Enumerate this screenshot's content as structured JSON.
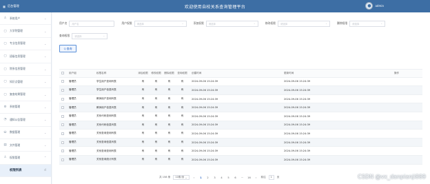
{
  "brand": {
    "name": "后台管理"
  },
  "header": {
    "title": "欢迎使用自校关系查询管理平台",
    "username": "admin"
  },
  "sidebar": {
    "items": [
      {
        "label": "系统用户"
      },
      {
        "label": "大学院管理"
      },
      {
        "label": "专业信息管理"
      },
      {
        "label": "班级信息管理"
      },
      {
        "label": "院系信息管理"
      },
      {
        "label": "知识点管理"
      },
      {
        "label": "复查结果管理"
      },
      {
        "label": "系统管理"
      },
      {
        "label": "通知公告管理"
      },
      {
        "label": "数据管理"
      },
      {
        "label": "文件管理"
      },
      {
        "label": "权限管理"
      },
      {
        "label": "权限列表"
      }
    ]
  },
  "filters": {
    "username_label": "用户名",
    "username_placeholder": "用户名",
    "perm1_label": "用户权限",
    "perm1_placeholder": "请选择",
    "perm2_label": "添加权限",
    "perm2_placeholder": "请选择",
    "perm3_label": "修改权限",
    "perm3_placeholder": "请选择",
    "perm4_label": "删除权限",
    "perm4_placeholder": "请选择",
    "perm5_label": "查询权限",
    "perm5_placeholder": "请选择",
    "search_button": "Q 查询"
  },
  "table": {
    "headers": [
      "用户组",
      "权限名称",
      "添加权限",
      "修改权限",
      "删除权限",
      "查询权限",
      "创建时间",
      "更新时间",
      "操作"
    ],
    "rows": [
      {
        "user": "管理员",
        "name": "学生用户查询列表",
        "p": [
          "有",
          "有",
          "有",
          "有"
        ],
        "created": "2024-09-06 15:24:39",
        "updated": "2024-09-06 15:24:39"
      },
      {
        "user": "管理员",
        "name": "学生用户信息列表",
        "p": [
          "有",
          "有",
          "有",
          "有"
        ],
        "created": "2024-09-06 15:24:39",
        "updated": "2024-09-06 15:24:39"
      },
      {
        "user": "管理员",
        "name": "教师用户查询列表",
        "p": [
          "有",
          "有",
          "有",
          "有"
        ],
        "created": "2024-09-06 15:24:39",
        "updated": "2024-09-06 15:24:39"
      },
      {
        "user": "管理员",
        "name": "教师用户信息列表",
        "p": [
          "有",
          "有",
          "有",
          "有"
        ],
        "created": "2024-09-06 15:24:39",
        "updated": "2024-09-06 15:24:39"
      },
      {
        "user": "管理员",
        "name": "关系代码查询列表",
        "p": [
          "有",
          "有",
          "有",
          "有"
        ],
        "created": "2024-09-06 15:24:39",
        "updated": "2024-09-06 15:24:39"
      },
      {
        "user": "管理员",
        "name": "关系代码信息列表",
        "p": [
          "有",
          "有",
          "有",
          "有"
        ],
        "created": "2024-09-06 15:24:39",
        "updated": "2024-09-06 15:24:39"
      },
      {
        "user": "管理员",
        "name": "关系查询查询列表",
        "p": [
          "有",
          "有",
          "有",
          "有"
        ],
        "created": "2024-09-06 15:24:39",
        "updated": "2024-09-06 15:24:39"
      },
      {
        "user": "管理员",
        "name": "关系查询信息列表",
        "p": [
          "有",
          "有",
          "有",
          "有"
        ],
        "created": "2024-09-06 15:24:39",
        "updated": "2024-09-06 15:24:39"
      },
      {
        "user": "管理员",
        "name": "关系查询查询列表",
        "p": [
          "有",
          "有",
          "有",
          "有"
        ],
        "created": "2024-09-06 15:24:39",
        "updated": "2024-09-06 15:24:39"
      },
      {
        "user": "管理员",
        "name": "关系查询统计列表",
        "p": [
          "有",
          "有",
          "有",
          "有"
        ],
        "created": "2024-09-06 15:24:39",
        "updated": "2024-09-06 15:24:39"
      }
    ]
  },
  "pager": {
    "total": "共 158 条",
    "page_size": "10条/页",
    "prev": "‹",
    "pages": [
      "1",
      "2",
      "3",
      "4",
      "5",
      "6",
      "···",
      "16"
    ],
    "next": "›",
    "goto_label": "前往",
    "goto_value": "1",
    "goto_suffix": "页"
  },
  "watermark": "CSDN @vx_danpianji889"
}
